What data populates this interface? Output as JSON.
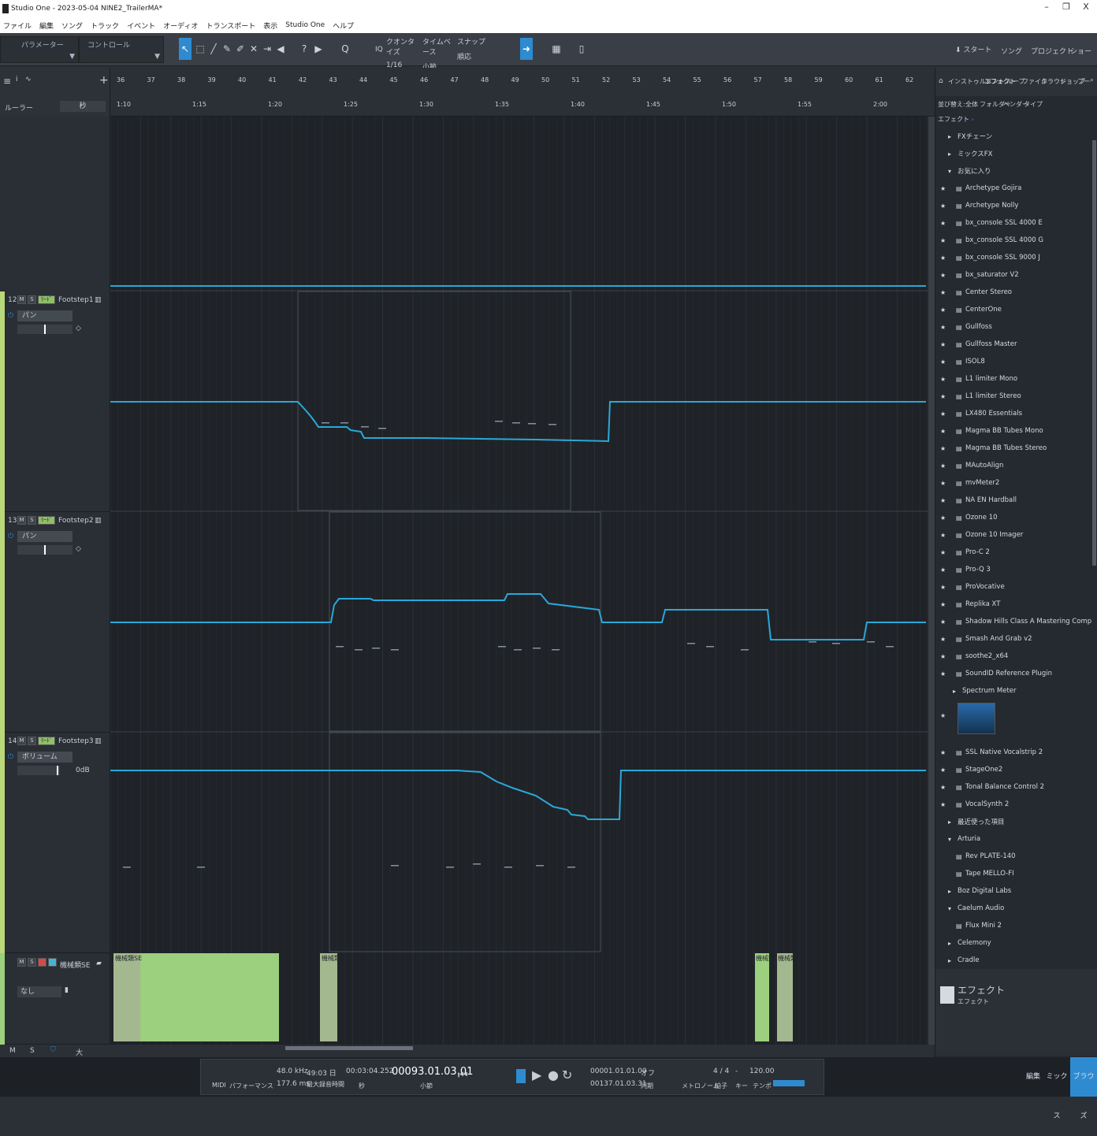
{
  "window": {
    "title": "Studio One - 2023-05-04 NINE2_TrailerMA*",
    "minimize": "–",
    "restore": "❐",
    "close": "X"
  },
  "menu": [
    "ファイル",
    "編集",
    "ソング",
    "トラック",
    "イベント",
    "オーディオ",
    "トランスポート",
    "表示",
    "Studio One",
    "ヘルプ"
  ],
  "toolbar": {
    "param_label": "パラメーター",
    "control_label": "コントロール",
    "iq": "IQ",
    "quantize_label": "クオンタイズ",
    "quantize_value": "1/16",
    "timebase_label": "タイムベース",
    "timebase_value": "小節",
    "snap_label": "スナップ",
    "snap_value": "順応",
    "right": {
      "start": "スタート",
      "song": "ソング",
      "project": "プロジェクト",
      "show": "ショー"
    }
  },
  "left_header": {
    "ruler_label": "ルーラー",
    "unit": "秒"
  },
  "ruler": {
    "bars": [
      "36",
      "37",
      "38",
      "39",
      "40",
      "41",
      "42",
      "43",
      "44",
      "45",
      "46",
      "47",
      "48",
      "49",
      "50",
      "51",
      "52",
      "53",
      "54",
      "55",
      "56",
      "57",
      "58",
      "59",
      "60",
      "61",
      "62"
    ],
    "times": [
      "1:10",
      "1:15",
      "1:20",
      "1:25",
      "1:30",
      "1:35",
      "1:40",
      "1:45",
      "1:50",
      "1:55",
      "2:00"
    ]
  },
  "tracks": [
    {
      "num": "12",
      "m": "M",
      "s": "S",
      "mode": "ﾘｰﾄﾞ",
      "name": "Footstep1",
      "param": "パン",
      "value": ""
    },
    {
      "num": "13",
      "m": "M",
      "s": "S",
      "mode": "ﾘｰﾄﾞ",
      "name": "Footstep2",
      "param": "パン",
      "value": ""
    },
    {
      "num": "14",
      "m": "M",
      "s": "S",
      "mode": "ﾘｰﾄﾞ",
      "name": "Footstep3",
      "param": "ボリューム",
      "value": "0dB"
    }
  ],
  "audio_track": {
    "m": "M",
    "s": "S",
    "name": "機械類SE",
    "output": "なし",
    "clip_label": "機械類SE",
    "clip_label_short": "機械類S",
    "clip_label_tiny": "機械類"
  },
  "left_footer": {
    "m": "M",
    "s": "S",
    "size": "大"
  },
  "browser": {
    "tabs": [
      "インストゥルメント",
      "エフェクト",
      "ループ",
      "ファイル",
      "クラウド",
      "ショップ",
      "プー"
    ],
    "sort_label": "並び替え:",
    "sort_options": [
      "全体",
      "フォルダー",
      "ベンダー",
      "タイプ"
    ],
    "path": "エフェクト",
    "folders_top": [
      "FXチェーン",
      "ミックスFX",
      "お気に入り"
    ],
    "favorites": [
      "Archetype Gojira",
      "Archetype Nolly",
      "bx_console SSL 4000 E",
      "bx_console SSL 4000 G",
      "bx_console SSL 9000 J",
      "bx_saturator V2",
      "Center Stereo",
      "CenterOne",
      "Gullfoss",
      "Gullfoss Master",
      "ISOL8",
      "L1 limiter Mono",
      "L1 limiter Stereo",
      "LX480 Essentials",
      "Magma BB Tubes Mono",
      "Magma BB Tubes Stereo",
      "MAutoAlign",
      "mvMeter2",
      "NA EN Hardball",
      "Ozone 10",
      "Ozone 10 Imager",
      "Pro-C 2",
      "Pro-Q 3",
      "ProVocative",
      "Replika XT",
      "Shadow Hills Class A Mastering Comp",
      "Smash And Grab v2",
      "soothe2_x64",
      "SoundID Reference Plugin"
    ],
    "spectrum": "Spectrum Meter",
    "favorites2": [
      "SSL Native Vocalstrip 2",
      "StageOne2",
      "Tonal Balance Control 2",
      "VocalSynth 2"
    ],
    "recent": "最近使った項目",
    "vendors": [
      {
        "name": "Arturia",
        "items": [
          "Rev PLATE-140",
          "Tape MELLO-FI"
        ]
      },
      {
        "name": "Boz Digital Labs",
        "items": []
      },
      {
        "name": "Caelum Audio",
        "items": [
          "Flux Mini 2"
        ]
      },
      {
        "name": "Celemony",
        "items": []
      },
      {
        "name": "Cradle",
        "items": []
      }
    ],
    "footer_title": "エフェクト",
    "footer_sub": "エフェクト"
  },
  "transport": {
    "midi": "MIDI",
    "performance": "パフォーマンス",
    "sample_rate": "48.0 kHz",
    "latency": "177.6 ms",
    "record_time": "49:03 日",
    "record_label": "最大録音時間",
    "time": "00:03:04.252",
    "time_unit": "秒",
    "bars": "00093.01.03.01",
    "bars_unit": "小節",
    "loop_l": "00001.01.01.00",
    "loop_r": "00137.01.03.31",
    "sync": "オフ",
    "sync_label": "同期",
    "metronome_label": "メトロノーム",
    "signature": "4 / 4",
    "signature_label": "拍子",
    "key": "-",
    "key_label": "キー",
    "tempo": "120.00",
    "tempo_label": "テンポ"
  },
  "bottom_tabs": [
    "編集",
    "ミックス",
    "ブラウズ"
  ],
  "colors": {
    "accent": "#2e8bd0",
    "automation": "#2aa8d8",
    "clip": "#9ccf7e",
    "track_strip": "#b9d87a"
  }
}
